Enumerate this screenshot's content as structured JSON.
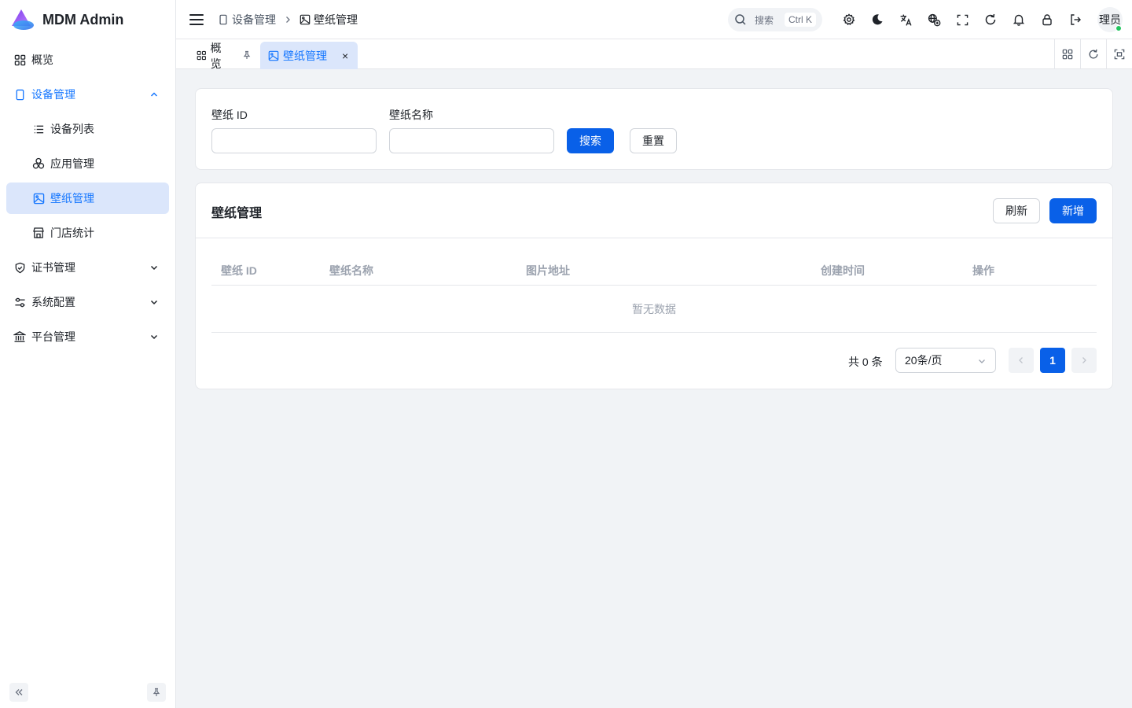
{
  "brand": {
    "title": "MDM Admin"
  },
  "sidebar": {
    "items": [
      {
        "label": "概览"
      },
      {
        "label": "设备管理"
      },
      {
        "label": "设备列表"
      },
      {
        "label": "应用管理"
      },
      {
        "label": "壁纸管理"
      },
      {
        "label": "门店统计"
      },
      {
        "label": "证书管理"
      },
      {
        "label": "系统配置"
      },
      {
        "label": "平台管理"
      }
    ]
  },
  "header": {
    "breadcrumb": [
      "设备管理",
      "壁纸管理"
    ],
    "search_placeholder": "搜索",
    "search_shortcut": "Ctrl K",
    "avatar_text": "理员"
  },
  "tabs": [
    {
      "label": "概览"
    },
    {
      "label": "壁纸管理",
      "close": "×"
    }
  ],
  "filter": {
    "id_label": "壁纸 ID",
    "name_label": "壁纸名称",
    "search_button": "搜索",
    "reset_button": "重置"
  },
  "table": {
    "title": "壁纸管理",
    "refresh_button": "刷新",
    "add_button": "新增",
    "columns": [
      "壁纸 ID",
      "壁纸名称",
      "图片地址",
      "创建时间",
      "操作"
    ],
    "empty_text": "暂无数据"
  },
  "pager": {
    "total": "共 0 条",
    "page_size": "20条/页",
    "current_page": "1"
  },
  "colors": {
    "accent": "#0960e8",
    "active_bg": "#dbe6fb",
    "page_bg": "#f1f3f6"
  }
}
